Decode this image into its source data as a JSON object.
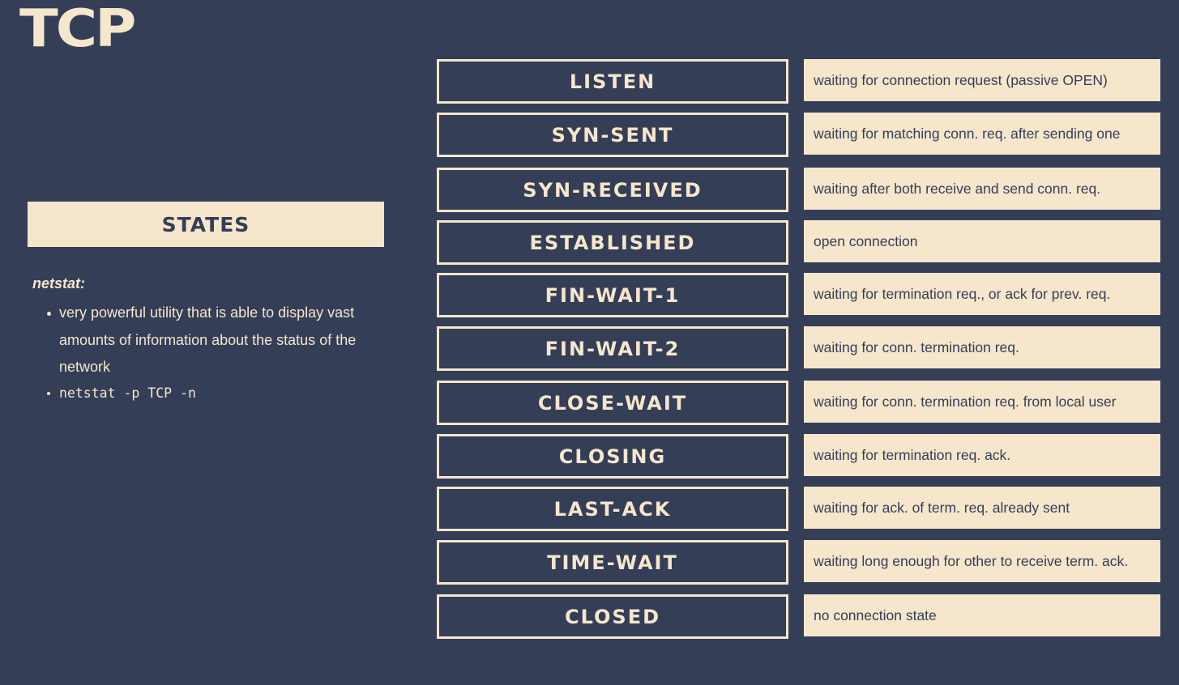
{
  "header": {
    "title": "TCP"
  },
  "sidebar": {
    "banner_label": "STATES",
    "notes_heading": "netstat:",
    "bullets": [
      "very powerful utility that is able to display vast amounts of information about the status of the network",
      "netstat -p TCP -n"
    ]
  },
  "states": [
    {
      "name": "LISTEN",
      "description": "waiting for connection request (passive OPEN)"
    },
    {
      "name": "SYN-SENT",
      "description": "waiting for matching conn. req. after sending one"
    },
    {
      "name": "SYN-RECEIVED",
      "description": "waiting after both receive and send conn. req."
    },
    {
      "name": "ESTABLISHED",
      "description": "open connection"
    },
    {
      "name": "FIN-WAIT-1",
      "description": "waiting for termination req., or ack for prev. req."
    },
    {
      "name": "FIN-WAIT-2",
      "description": "waiting for conn. termination req."
    },
    {
      "name": "CLOSE-WAIT",
      "description": "waiting for conn. termination req. from local user"
    },
    {
      "name": "CLOSING",
      "description": "waiting for termination req. ack."
    },
    {
      "name": "LAST-ACK",
      "description": "waiting for ack. of term. req. already sent"
    },
    {
      "name": "TIME-WAIT",
      "description": "waiting long enough for other to receive term. ack."
    },
    {
      "name": "CLOSED",
      "description": "no connection state"
    }
  ],
  "colors": {
    "background": "#353e57",
    "accent": "#f5e6cc"
  }
}
